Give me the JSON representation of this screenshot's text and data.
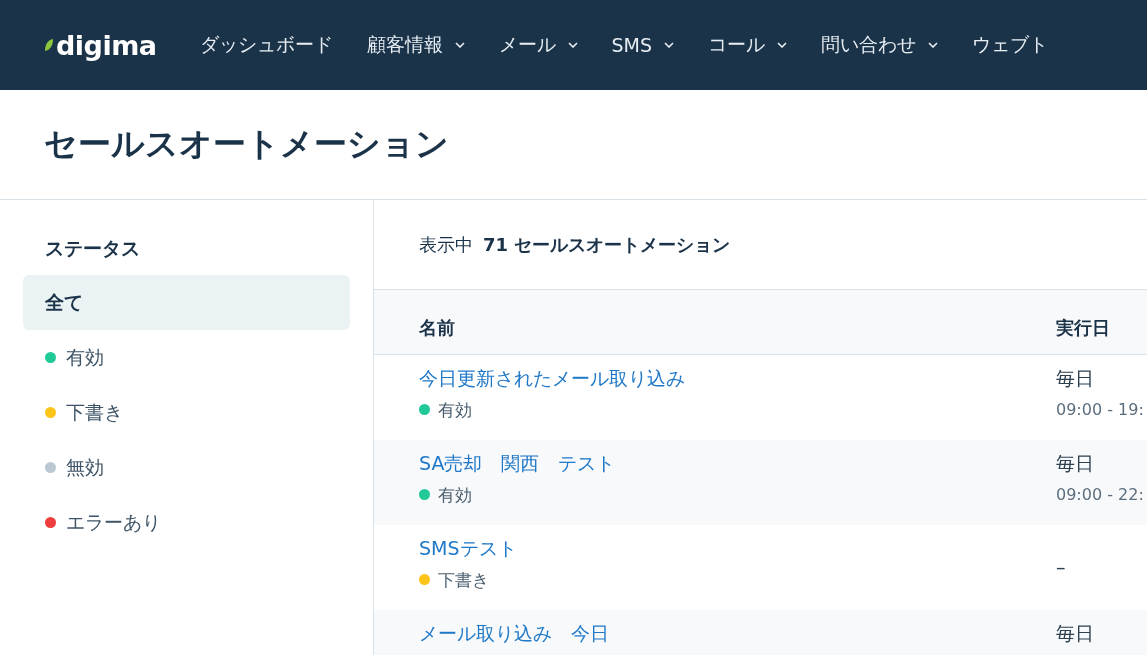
{
  "nav": {
    "logo": "digima",
    "items": [
      {
        "label": "ダッシュボード",
        "dropdown": false
      },
      {
        "label": "顧客情報",
        "dropdown": true
      },
      {
        "label": "メール",
        "dropdown": true
      },
      {
        "label": "SMS",
        "dropdown": true
      },
      {
        "label": "コール",
        "dropdown": true
      },
      {
        "label": "問い合わせ",
        "dropdown": true
      },
      {
        "label": "ウェブト",
        "dropdown": false
      }
    ]
  },
  "page": {
    "title": "セールスオートメーション"
  },
  "sidebar": {
    "heading": "ステータス",
    "items": [
      {
        "label": "全て",
        "selected": true
      },
      {
        "label": "有効",
        "selected": false,
        "color": "#20c997"
      },
      {
        "label": "下書き",
        "selected": false,
        "color": "#fcc419"
      },
      {
        "label": "無効",
        "selected": false,
        "color": "#bcc8d1"
      },
      {
        "label": "エラーあり",
        "selected": false,
        "color": "#f03e3e"
      }
    ]
  },
  "summary": {
    "prefix": "表示中",
    "count": "71 セールスオートメーション"
  },
  "table": {
    "columns": [
      "名前",
      "実行日"
    ],
    "rows": [
      {
        "name": "今日更新されたメール取り込み",
        "status": {
          "label": "有効",
          "color": "#20c997"
        },
        "schedule": "毎日",
        "time": "09:00 - 19:"
      },
      {
        "name": "SA売却　関西　テスト",
        "status": {
          "label": "有効",
          "color": "#20c997"
        },
        "schedule": "毎日",
        "time": "09:00 - 22:"
      },
      {
        "name": "SMSテスト",
        "status": {
          "label": "下書き",
          "color": "#fcc419"
        },
        "schedule": "–"
      },
      {
        "name": "メール取り込み　今日",
        "schedule": "毎日"
      }
    ]
  }
}
